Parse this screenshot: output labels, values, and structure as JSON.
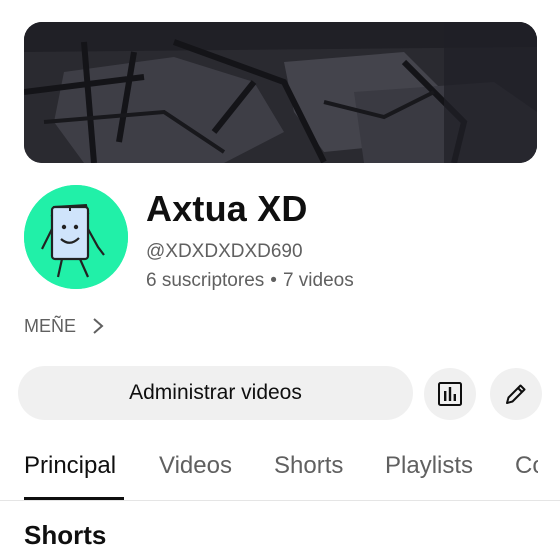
{
  "channel": {
    "name": "Axtua XD",
    "handle": "@XDXDXDXD690",
    "subscribers": "6 suscriptores",
    "separator": "•",
    "videos": "7 videos"
  },
  "more_link": {
    "label": "MEÑE",
    "icon": "chevron-right-icon"
  },
  "actions": {
    "manage_videos_label": "Administrar videos",
    "analytics_icon": "analytics-icon",
    "edit_icon": "pencil-icon"
  },
  "tabs": [
    {
      "label": "Principal",
      "active": true
    },
    {
      "label": "Videos",
      "active": false
    },
    {
      "label": "Shorts",
      "active": false
    },
    {
      "label": "Playlists",
      "active": false
    },
    {
      "label": "Co",
      "active": false,
      "partially_visible": true
    }
  ],
  "sections": {
    "shorts_title": "Shorts"
  },
  "colors": {
    "avatar_background": "#21f0a8",
    "button_background": "#f0f0f0",
    "secondary_text": "#606060",
    "primary_text": "#0f0f0f"
  }
}
